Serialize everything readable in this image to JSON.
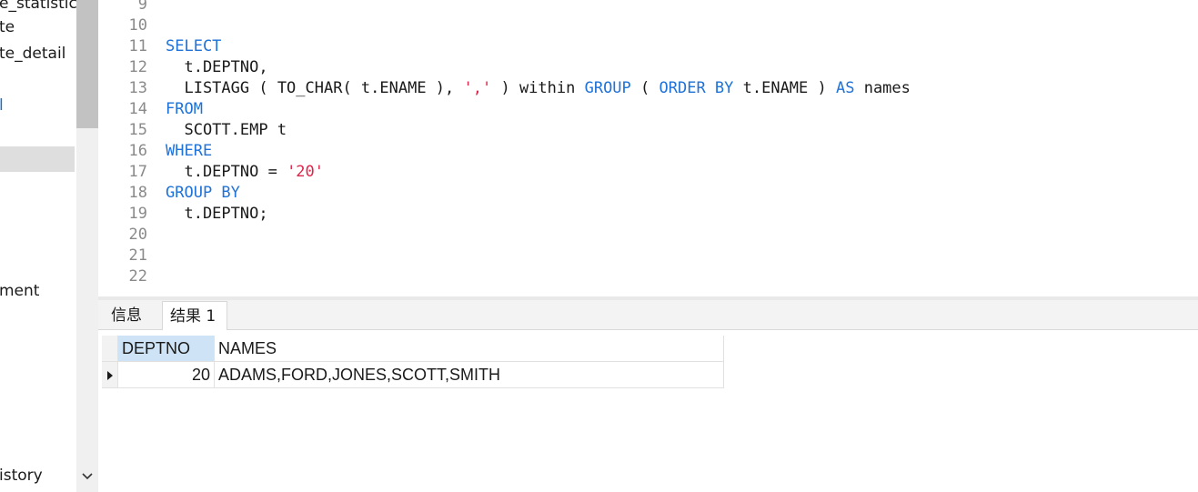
{
  "sidebar": {
    "items": [
      {
        "text": "e_statistic"
      },
      {
        "text": "te"
      },
      {
        "text": "te_detail"
      },
      {
        "text": "l"
      },
      {
        "text": "ment"
      },
      {
        "text": "istory"
      }
    ]
  },
  "editor": {
    "lines": [
      {
        "num": "9",
        "code": ""
      },
      {
        "num": "10",
        "code": ""
      },
      {
        "num": "11",
        "parts": [
          {
            "t": "SELECT",
            "k": "kw"
          }
        ]
      },
      {
        "num": "12",
        "parts": [
          {
            "t": "  t.DEPTNO,",
            "k": ""
          }
        ]
      },
      {
        "num": "13",
        "parts": [
          {
            "t": "  LISTAGG ( TO_CHAR( t.ENAME ), ",
            "k": ""
          },
          {
            "t": "','",
            "k": "str"
          },
          {
            "t": " ) within ",
            "k": ""
          },
          {
            "t": "GROUP",
            "k": "kw"
          },
          {
            "t": " ( ",
            "k": ""
          },
          {
            "t": "ORDER BY",
            "k": "kw"
          },
          {
            "t": " t.ENAME ) ",
            "k": ""
          },
          {
            "t": "AS",
            "k": "kw"
          },
          {
            "t": " names",
            "k": ""
          }
        ]
      },
      {
        "num": "14",
        "parts": [
          {
            "t": "FROM",
            "k": "kw"
          }
        ]
      },
      {
        "num": "15",
        "parts": [
          {
            "t": "  SCOTT.EMP t",
            "k": ""
          }
        ]
      },
      {
        "num": "16",
        "parts": [
          {
            "t": "WHERE",
            "k": "kw"
          }
        ]
      },
      {
        "num": "17",
        "parts": [
          {
            "t": "  t.DEPTNO = ",
            "k": ""
          },
          {
            "t": "'20'",
            "k": "str"
          }
        ]
      },
      {
        "num": "18",
        "parts": [
          {
            "t": "GROUP BY",
            "k": "kw"
          }
        ]
      },
      {
        "num": "19",
        "parts": [
          {
            "t": "  t.DEPTNO;",
            "k": ""
          }
        ]
      },
      {
        "num": "20",
        "code": ""
      },
      {
        "num": "21",
        "code": ""
      },
      {
        "num": "22",
        "code": ""
      }
    ]
  },
  "tabs": {
    "info": "信息",
    "result": "结果 1"
  },
  "grid": {
    "columns": [
      "DEPTNO",
      "NAMES"
    ],
    "rows": [
      [
        "20",
        "ADAMS,FORD,JONES,SCOTT,SMITH"
      ]
    ]
  },
  "colors": {
    "keyword": "#1e72d8",
    "string": "#e0244a",
    "selected_header": "#cfe3f7"
  }
}
